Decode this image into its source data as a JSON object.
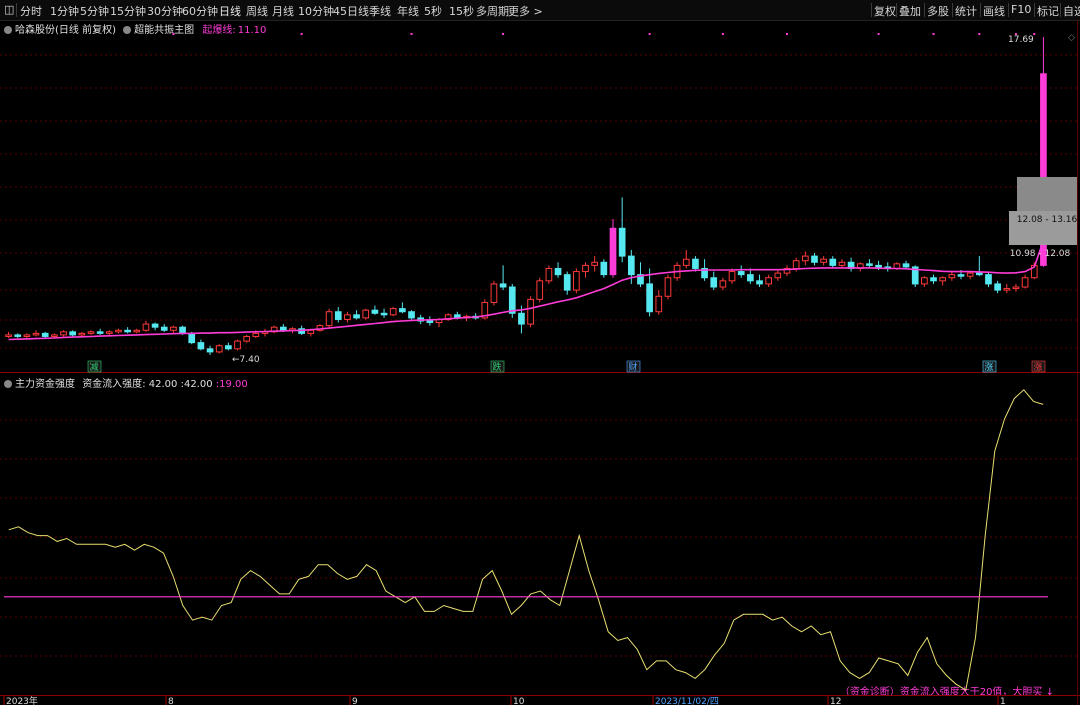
{
  "toolbar": {
    "left": [
      "分时",
      "1分钟",
      "5分钟",
      "15分钟",
      "30分钟",
      "60分钟",
      "日线",
      "周线",
      "月线",
      "10分钟",
      "45日线",
      "季线",
      "年线",
      "5秒",
      "15秒",
      "多周期",
      "更多 >"
    ],
    "right": [
      "复权",
      "叠加",
      "多股",
      "统计",
      "画线",
      "F10",
      "标记",
      "自选"
    ],
    "active": "日线"
  },
  "main_legend": {
    "stock": "哈森股份",
    "period": "(日线 前复权)",
    "indicator": "超能共振主图",
    "line_label": "起爆线",
    "line_value": "11.10"
  },
  "sub_legend": {
    "indicator": "主力资金强度",
    "label": "资金流入强度",
    "value1": "42.00",
    "value2": "42.00",
    "threshold": "19.00"
  },
  "price_labels": {
    "high": "17.69",
    "low": "7.40",
    "box1": "12.08 - 13.16",
    "box2": "10.98 - 12.08"
  },
  "markers": [
    {
      "text": "减",
      "color": "#2ecc71"
    },
    {
      "text": "跌",
      "color": "#2ecc71"
    },
    {
      "text": "财",
      "color": "#4da3ff"
    },
    {
      "text": "涨",
      "color": "#4dd8ff"
    },
    {
      "text": "涨",
      "color": "#ff3a3a"
    }
  ],
  "diag_note": "（资金诊断）资金流入强度大于20值，大胆买 ↓",
  "x_labels": [
    "2023年",
    "8",
    "9",
    "10",
    "2023/11/02/四",
    "12",
    "1"
  ],
  "colors": {
    "up": "#ff3a3a",
    "down": "#55e8f0",
    "pink": "#ff3cd8",
    "yellow": "#e8e070",
    "grid": "#5a0000"
  },
  "chart_data": [
    {
      "type": "candlestick",
      "title": "超能共振主图",
      "series_name": "起爆线",
      "y_reference": {
        "max_label": 17.69,
        "min_label": 7.4
      },
      "ohlc": [
        [
          8.0,
          8.15,
          7.95,
          8.05
        ],
        [
          8.05,
          8.1,
          7.95,
          8.0
        ],
        [
          8.0,
          8.1,
          7.9,
          8.05
        ],
        [
          8.05,
          8.2,
          8.0,
          8.1
        ],
        [
          8.1,
          8.15,
          7.95,
          8.0
        ],
        [
          8.0,
          8.1,
          7.95,
          8.05
        ],
        [
          8.05,
          8.2,
          8.0,
          8.15
        ],
        [
          8.15,
          8.2,
          8.0,
          8.05
        ],
        [
          8.05,
          8.15,
          7.98,
          8.1
        ],
        [
          8.1,
          8.2,
          8.05,
          8.15
        ],
        [
          8.15,
          8.25,
          8.05,
          8.1
        ],
        [
          8.1,
          8.2,
          8.05,
          8.15
        ],
        [
          8.15,
          8.25,
          8.1,
          8.2
        ],
        [
          8.2,
          8.3,
          8.1,
          8.15
        ],
        [
          8.15,
          8.25,
          8.1,
          8.2
        ],
        [
          8.2,
          8.5,
          8.15,
          8.4
        ],
        [
          8.4,
          8.45,
          8.2,
          8.3
        ],
        [
          8.3,
          8.4,
          8.15,
          8.2
        ],
        [
          8.2,
          8.35,
          8.1,
          8.3
        ],
        [
          8.3,
          8.35,
          8.05,
          8.1
        ],
        [
          8.1,
          8.15,
          7.75,
          7.8
        ],
        [
          7.8,
          7.9,
          7.55,
          7.6
        ],
        [
          7.6,
          7.7,
          7.4,
          7.5
        ],
        [
          7.5,
          7.75,
          7.45,
          7.7
        ],
        [
          7.7,
          7.8,
          7.55,
          7.6
        ],
        [
          7.6,
          7.9,
          7.55,
          7.85
        ],
        [
          7.85,
          8.05,
          7.8,
          8.0
        ],
        [
          8.0,
          8.2,
          7.95,
          8.1
        ],
        [
          8.1,
          8.25,
          8.0,
          8.15
        ],
        [
          8.15,
          8.35,
          8.1,
          8.3
        ],
        [
          8.3,
          8.4,
          8.15,
          8.2
        ],
        [
          8.2,
          8.3,
          8.1,
          8.25
        ],
        [
          8.25,
          8.35,
          8.05,
          8.1
        ],
        [
          8.1,
          8.25,
          8.0,
          8.2
        ],
        [
          8.2,
          8.4,
          8.15,
          8.35
        ],
        [
          8.35,
          8.9,
          8.3,
          8.8
        ],
        [
          8.8,
          8.95,
          8.45,
          8.55
        ],
        [
          8.55,
          8.8,
          8.45,
          8.7
        ],
        [
          8.7,
          8.85,
          8.55,
          8.6
        ],
        [
          8.6,
          8.9,
          8.55,
          8.85
        ],
        [
          8.85,
          9.0,
          8.7,
          8.75
        ],
        [
          8.75,
          8.9,
          8.6,
          8.7
        ],
        [
          8.7,
          8.95,
          8.65,
          8.9
        ],
        [
          8.9,
          9.1,
          8.75,
          8.8
        ],
        [
          8.8,
          8.85,
          8.55,
          8.6
        ],
        [
          8.6,
          8.7,
          8.4,
          8.5
        ],
        [
          8.5,
          8.65,
          8.35,
          8.45
        ],
        [
          8.45,
          8.6,
          8.3,
          8.55
        ],
        [
          8.55,
          8.75,
          8.5,
          8.7
        ],
        [
          8.7,
          8.8,
          8.55,
          8.6
        ],
        [
          8.6,
          8.7,
          8.5,
          8.65
        ],
        [
          8.65,
          8.75,
          8.55,
          8.6
        ],
        [
          8.6,
          9.2,
          8.55,
          9.1
        ],
        [
          9.1,
          9.8,
          9.0,
          9.7
        ],
        [
          9.7,
          10.3,
          9.5,
          9.6
        ],
        [
          9.6,
          9.7,
          8.6,
          8.75
        ],
        [
          8.75,
          9.0,
          8.1,
          8.4
        ],
        [
          8.4,
          9.3,
          8.3,
          9.2
        ],
        [
          9.2,
          9.9,
          9.1,
          9.8
        ],
        [
          9.8,
          10.3,
          9.7,
          10.2
        ],
        [
          10.2,
          10.4,
          9.9,
          10.0
        ],
        [
          10.0,
          10.1,
          9.35,
          9.5
        ],
        [
          9.5,
          10.2,
          9.4,
          10.1
        ],
        [
          10.1,
          10.4,
          9.9,
          10.3
        ],
        [
          10.3,
          10.6,
          10.1,
          10.4
        ],
        [
          10.4,
          10.5,
          9.9,
          10.0
        ],
        [
          10.0,
          11.8,
          9.9,
          11.5
        ],
        [
          11.5,
          12.5,
          10.4,
          10.6
        ],
        [
          10.6,
          10.8,
          9.7,
          10.0
        ],
        [
          10.0,
          10.4,
          9.6,
          9.7
        ],
        [
          9.7,
          10.2,
          8.65,
          8.8
        ],
        [
          8.8,
          9.5,
          8.7,
          9.3
        ],
        [
          9.3,
          10.0,
          9.2,
          9.9
        ],
        [
          9.9,
          10.4,
          9.8,
          10.3
        ],
        [
          10.3,
          10.8,
          10.2,
          10.5
        ],
        [
          10.5,
          10.6,
          10.1,
          10.2
        ],
        [
          10.2,
          10.5,
          9.8,
          9.9
        ],
        [
          9.9,
          10.1,
          9.5,
          9.6
        ],
        [
          9.6,
          9.9,
          9.5,
          9.8
        ],
        [
          9.8,
          10.2,
          9.7,
          10.1
        ],
        [
          10.1,
          10.3,
          9.9,
          10.0
        ],
        [
          10.0,
          10.2,
          9.7,
          9.8
        ],
        [
          9.8,
          10.0,
          9.6,
          9.7
        ],
        [
          9.7,
          10.0,
          9.6,
          9.9
        ],
        [
          9.9,
          10.15,
          9.8,
          10.05
        ],
        [
          10.05,
          10.3,
          9.95,
          10.2
        ],
        [
          10.2,
          10.55,
          10.1,
          10.45
        ],
        [
          10.45,
          10.75,
          10.3,
          10.6
        ],
        [
          10.6,
          10.7,
          10.3,
          10.4
        ],
        [
          10.4,
          10.6,
          10.3,
          10.5
        ],
        [
          10.5,
          10.6,
          10.2,
          10.3
        ],
        [
          10.3,
          10.5,
          10.2,
          10.4
        ],
        [
          10.4,
          10.55,
          10.1,
          10.2
        ],
        [
          10.2,
          10.4,
          10.1,
          10.35
        ],
        [
          10.35,
          10.5,
          10.2,
          10.3
        ],
        [
          10.3,
          10.45,
          10.15,
          10.25
        ],
        [
          10.25,
          10.4,
          10.1,
          10.2
        ],
        [
          10.2,
          10.4,
          10.15,
          10.35
        ],
        [
          10.35,
          10.45,
          10.2,
          10.25
        ],
        [
          10.25,
          10.3,
          9.6,
          9.7
        ],
        [
          9.7,
          9.95,
          9.6,
          9.9
        ],
        [
          9.9,
          10.0,
          9.7,
          9.8
        ],
        [
          9.8,
          9.95,
          9.65,
          9.9
        ],
        [
          9.9,
          10.1,
          9.8,
          10.0
        ],
        [
          10.0,
          10.15,
          9.85,
          9.95
        ],
        [
          9.95,
          10.1,
          9.85,
          10.05
        ],
        [
          10.05,
          10.6,
          9.95,
          10.0
        ],
        [
          10.0,
          10.1,
          9.6,
          9.7
        ],
        [
          9.7,
          9.8,
          9.4,
          9.5
        ],
        [
          9.5,
          9.7,
          9.4,
          9.55
        ],
        [
          9.55,
          9.7,
          9.45,
          9.6
        ],
        [
          9.6,
          10.0,
          9.55,
          9.9
        ],
        [
          9.9,
          10.4,
          9.85,
          10.3
        ],
        [
          10.3,
          17.69,
          10.25,
          16.5
        ]
      ],
      "line_series": {
        "name": "起爆线",
        "values": [
          7.9,
          7.91,
          7.92,
          7.93,
          7.94,
          7.95,
          7.97,
          7.98,
          7.99,
          8.0,
          8.01,
          8.02,
          8.03,
          8.04,
          8.05,
          8.06,
          8.07,
          8.08,
          8.09,
          8.1,
          8.1,
          8.11,
          8.11,
          8.12,
          8.12,
          8.13,
          8.14,
          8.15,
          8.16,
          8.17,
          8.18,
          8.19,
          8.2,
          8.22,
          8.24,
          8.27,
          8.3,
          8.33,
          8.36,
          8.39,
          8.42,
          8.45,
          8.48,
          8.5,
          8.52,
          8.53,
          8.54,
          8.55,
          8.57,
          8.59,
          8.61,
          8.63,
          8.67,
          8.72,
          8.78,
          8.83,
          8.86,
          8.91,
          8.98,
          9.05,
          9.12,
          9.18,
          9.25,
          9.35,
          9.45,
          9.55,
          9.68,
          9.82,
          9.9,
          9.96,
          10.0,
          10.04,
          10.07,
          10.1,
          10.12,
          10.14,
          10.15,
          10.15,
          10.15,
          10.15,
          10.16,
          10.16,
          10.16,
          10.16,
          10.16,
          10.17,
          10.18,
          10.2,
          10.21,
          10.22,
          10.22,
          10.22,
          10.22,
          10.22,
          10.22,
          10.21,
          10.2,
          10.2,
          10.19,
          10.17,
          10.15,
          10.13,
          10.11,
          10.1,
          10.1,
          10.1,
          10.09,
          10.08,
          10.06,
          10.05,
          10.06,
          10.1,
          10.25,
          11.1
        ]
      }
    },
    {
      "type": "line",
      "title": "主力资金强度",
      "series": [
        {
          "name": "资金流入强度",
          "values": [
            42,
            43,
            41,
            40,
            40,
            38,
            39,
            37,
            37,
            37,
            37,
            36,
            37,
            35,
            37,
            36,
            34,
            26,
            16,
            11,
            12,
            11,
            16,
            17,
            25,
            28,
            26,
            23,
            20,
            20,
            25,
            26,
            30,
            30,
            27,
            25,
            26,
            30,
            28,
            21,
            19,
            17,
            19,
            14,
            14,
            16,
            15,
            14,
            14,
            25,
            28,
            21,
            13,
            16,
            20,
            21,
            18,
            16,
            28,
            40,
            28,
            18,
            7,
            4,
            5,
            1,
            -6,
            -3,
            -3,
            -6,
            -7,
            -9,
            -6,
            -1,
            3,
            11,
            13,
            13,
            13,
            11,
            12,
            9,
            7,
            9,
            6,
            7,
            -3,
            -7,
            -9,
            -7,
            -2,
            -3,
            -4,
            -8,
            0,
            5,
            -4,
            -8,
            -11,
            -13,
            5,
            40,
            69,
            80,
            87,
            90,
            86,
            85
          ]
        }
      ],
      "reference_line": {
        "name": "阈值",
        "value": 19
      },
      "xlabel": "",
      "ylabel": ""
    }
  ]
}
